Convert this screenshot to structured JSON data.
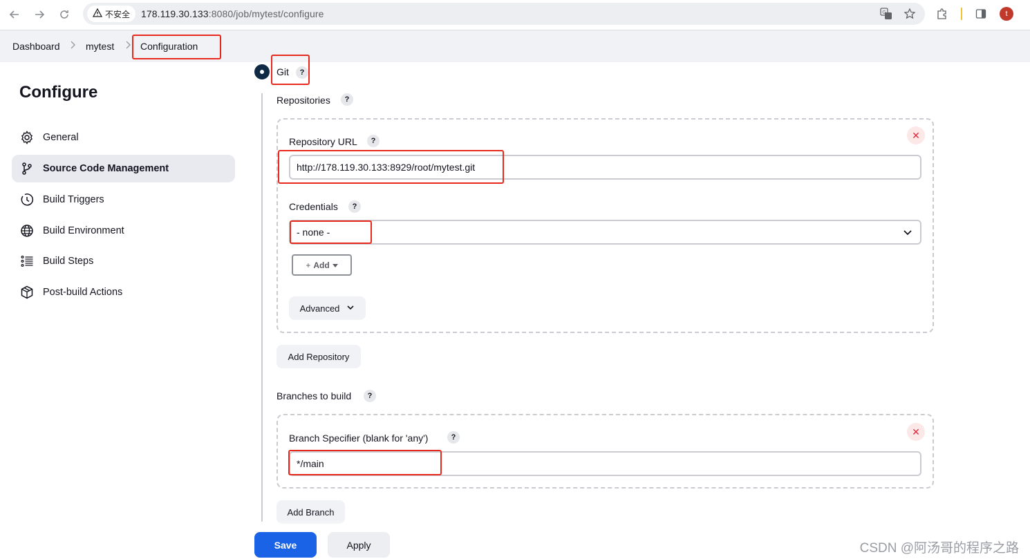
{
  "browser": {
    "security_label": "不安全",
    "url_host": "178.119.30.133",
    "url_path": ":8080/job/mytest/configure",
    "avatar_letter": "t",
    "icons": [
      "back-icon",
      "forward-icon",
      "reload-icon",
      "translate-icon",
      "star-icon",
      "extensions-icon",
      "side-panel-icon"
    ]
  },
  "breadcrumb": {
    "items": [
      "Dashboard",
      "mytest",
      "Configuration"
    ]
  },
  "sidebar": {
    "title": "Configure",
    "items": [
      {
        "label": "General",
        "icon": "gear-icon"
      },
      {
        "label": "Source Code Management",
        "icon": "branch-icon",
        "active": true
      },
      {
        "label": "Build Triggers",
        "icon": "clock-icon"
      },
      {
        "label": "Build Environment",
        "icon": "globe-icon"
      },
      {
        "label": "Build Steps",
        "icon": "list-icon"
      },
      {
        "label": "Post-build Actions",
        "icon": "package-icon"
      }
    ]
  },
  "scm": {
    "option_label": "Git",
    "help": "?",
    "repositories_label": "Repositories",
    "repository_url_label": "Repository URL",
    "repository_url_value": "http://178.119.30.133:8929/root/mytest.git",
    "credentials_label": "Credentials",
    "credentials_value": "- none -",
    "add_label": "Add",
    "advanced_label": "Advanced",
    "add_repository_label": "Add Repository",
    "branches_label": "Branches to build",
    "branch_specifier_label": "Branch Specifier (blank for 'any')",
    "branch_specifier_value": "*/main",
    "add_branch_label": "Add Branch",
    "delete_glyph": "✕"
  },
  "footer": {
    "save_label": "Save",
    "apply_label": "Apply"
  },
  "watermark": "CSDN @阿汤哥的程序之路",
  "colors": {
    "primary": "#1a63e6",
    "annotation_red": "#e8281d",
    "radio": "#0f2a44",
    "delete": "#e0283c"
  }
}
